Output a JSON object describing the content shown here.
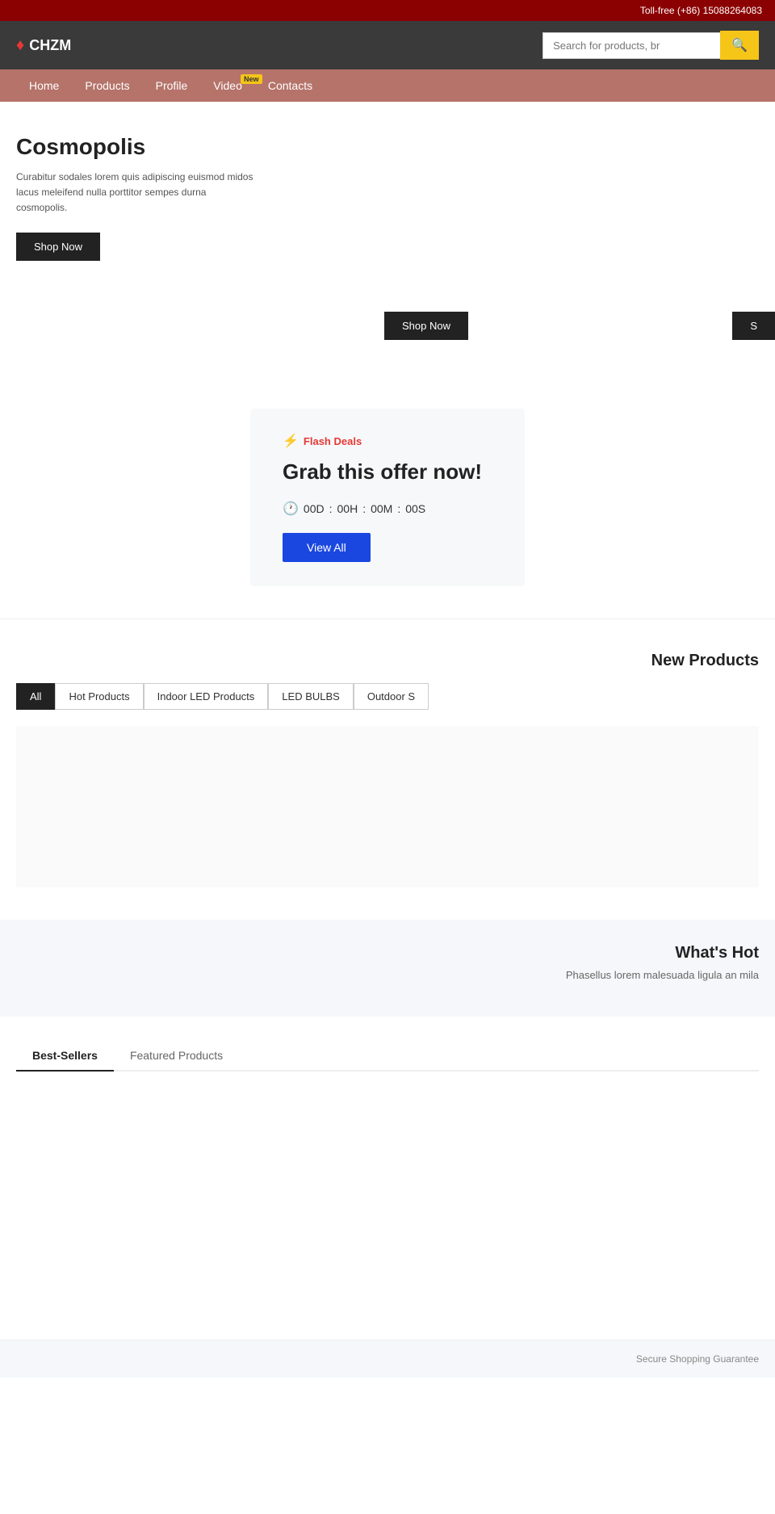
{
  "topbar": {
    "phone": "Toll-free (+86) 15088264083"
  },
  "header": {
    "logo_text": "CHZM",
    "search_placeholder": "Search for products, br"
  },
  "nav": {
    "items": [
      {
        "label": "Home",
        "id": "home"
      },
      {
        "label": "Products",
        "id": "products"
      },
      {
        "label": "Profile",
        "id": "profile"
      },
      {
        "label": "Video",
        "id": "video"
      },
      {
        "label": "Contacts",
        "id": "contacts"
      }
    ],
    "new_badge": "New"
  },
  "hero": {
    "title": "Cosmopolis",
    "description": "Curabitur sodales lorem quis adipiscing euismod midos lacus meleifend nulla porttitor sempes durna cosmopolis.",
    "shop_now_label": "Shop Now",
    "shop_now_right_label": "Shop Now",
    "shop_now_far_right_label": "S"
  },
  "flash_deals": {
    "icon": "⚡",
    "label": "Flash Deals",
    "title": "Grab this offer now!",
    "countdown": {
      "days": "00D",
      "hours": "00H",
      "minutes": "00M",
      "seconds": "00S"
    },
    "view_all_label": "View All"
  },
  "new_products": {
    "section_title": "New Products",
    "tabs": [
      {
        "label": "All",
        "active": true
      },
      {
        "label": "Hot Products",
        "active": false
      },
      {
        "label": "Indoor LED Products",
        "active": false
      },
      {
        "label": "LED BULBS",
        "active": false
      },
      {
        "label": "Outdoor S",
        "active": false
      }
    ]
  },
  "whats_hot": {
    "title": "What's Hot",
    "description": "Phasellus lorem malesuada ligula an mila"
  },
  "best_sellers": {
    "tabs": [
      {
        "label": "Best-Sellers",
        "active": true
      },
      {
        "label": "Featured Products",
        "active": false
      }
    ]
  },
  "footer": {
    "secure_label": "Secure Shopping Guarantee"
  }
}
